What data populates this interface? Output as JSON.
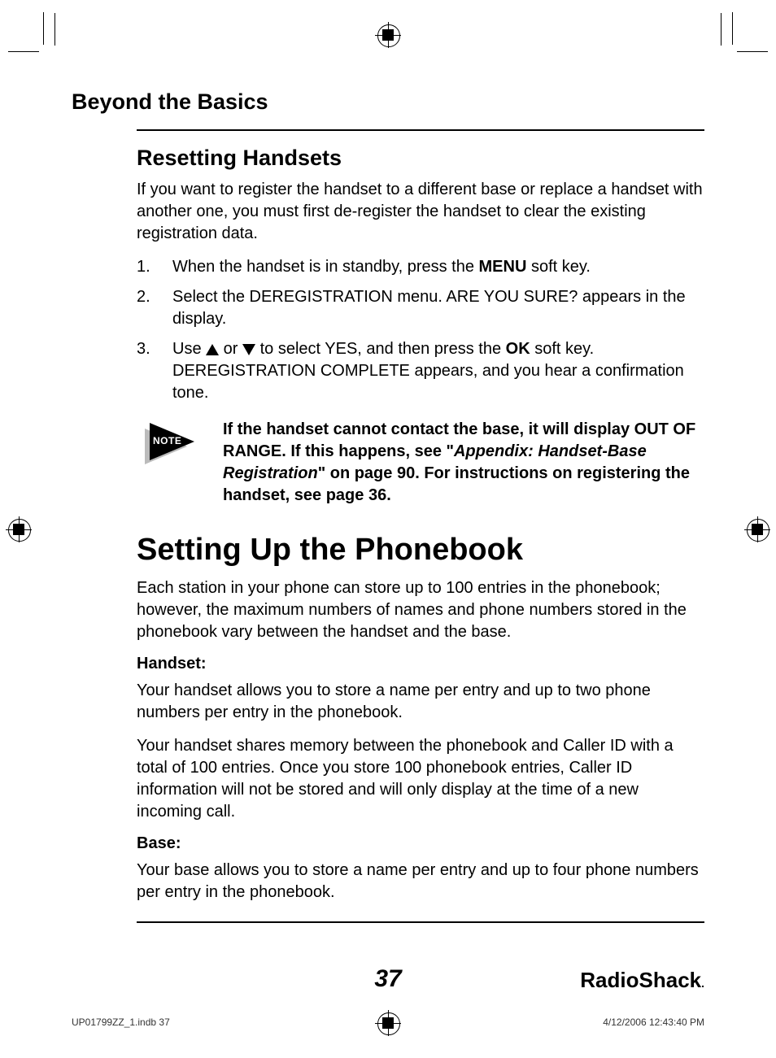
{
  "header": {
    "section_title": "Beyond the Basics"
  },
  "resetting": {
    "heading": "Resetting Handsets",
    "intro": "If you want to register the handset to a different base or replace a handset with another one, you must first de-register the handset to clear the existing registration data.",
    "steps": {
      "s1_num": "1.",
      "s1_a": "When the handset is in standby, press the ",
      "s1_menu": "MENU",
      "s1_b": " soft key.",
      "s2_num": "2.",
      "s2": "Select the DEREGISTRATION menu. ARE YOU SURE? appears in the display.",
      "s3_num": "3.",
      "s3_a": "Use ",
      "s3_b": " or ",
      "s3_c": " to select YES, and then press the ",
      "s3_ok": "OK",
      "s3_d": " soft key. DEREGISTRATION COMPLETE appears, and you hear a confirmation tone."
    },
    "note": {
      "label": "NOTE",
      "line1": "If the handset cannot contact the base, it will display OUT OF RANGE. If this happens, see \"",
      "appendix": "Appendix: Handset-Base Registration",
      "line2": "\" on page 90. For instructions on registering the handset, see page 36."
    }
  },
  "phonebook": {
    "heading": "Setting Up the Phonebook",
    "intro": "Each station in your phone can store up to 100 entries in the phonebook; however, the maximum numbers of names and phone numbers stored in the phonebook vary between the handset and the base.",
    "handset_label": "Handset:",
    "handset_p1": "Your handset allows you to store a name per entry and up to two phone numbers per entry in the phonebook.",
    "handset_p2": "Your handset shares memory between the phonebook and Caller ID with a total of 100 entries. Once you store 100 phonebook entries, Caller ID information will not be stored and will only display at the time of a new incoming call.",
    "base_label": "Base:",
    "base_p1": "Your base allows you to store a name per entry and up to four phone numbers per entry in the phonebook."
  },
  "footer": {
    "page_number": "37",
    "brand": "RadioShack",
    "brand_dot": "."
  },
  "print": {
    "file": "UP01799ZZ_1.indb   37",
    "timestamp": "4/12/2006   12:43:40 PM"
  }
}
